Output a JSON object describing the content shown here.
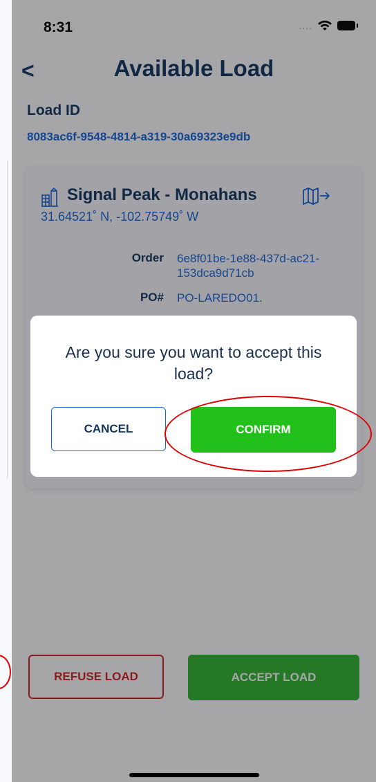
{
  "status_bar": {
    "time": "8:31",
    "signal_dots": "...."
  },
  "header": {
    "back_glyph": "<",
    "title": "Available Load"
  },
  "load": {
    "id_label": "Load ID",
    "id_value": "8083ac6f-9548-4814-a319-30a69323e9db"
  },
  "card": {
    "site_name": "Signal Peak - Monahans",
    "coordinates": "31.64521˚ N, -102.75749˚ W",
    "order_label": "Order",
    "order_value": "6e8f01be-1e88-437d-ac21-153dca9d71cb",
    "po_label": "PO#",
    "po_value": "PO-LAREDO01."
  },
  "dialog": {
    "message": "Are you sure you want to accept this load?",
    "cancel_label": "CANCEL",
    "confirm_label": "CONFIRM"
  },
  "actions": {
    "refuse_label": "REFUSE LOAD",
    "accept_label": "ACCEPT LOAD"
  },
  "colors": {
    "brand_navy": "#10355f",
    "link_blue": "#1565d8",
    "confirm_green": "#22c01a",
    "accept_green": "#2eb52e",
    "refuse_red": "#d41d1d",
    "annotation_red": "#e00000"
  }
}
